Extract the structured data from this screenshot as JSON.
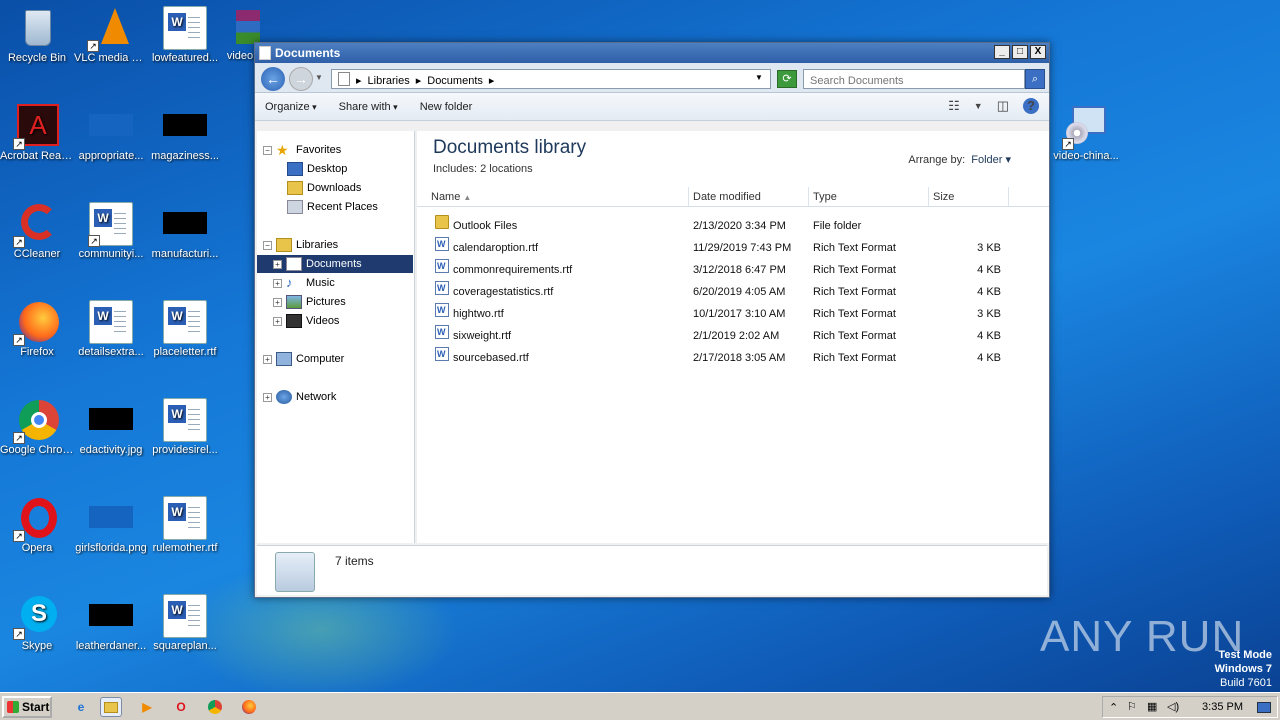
{
  "desktop": {
    "icons": [
      {
        "label": "Recycle Bin"
      },
      {
        "label": "VLC media player"
      },
      {
        "label": "lowfeatured..."
      },
      {
        "label": "video"
      },
      {
        "label": "Acrobat Reader DC"
      },
      {
        "label": "appropriate..."
      },
      {
        "label": "magaziness..."
      },
      {
        "label": "CCleaner"
      },
      {
        "label": "communityi..."
      },
      {
        "label": "manufacturi..."
      },
      {
        "label": "Firefox"
      },
      {
        "label": "detailsextra..."
      },
      {
        "label": "placeletter.rtf"
      },
      {
        "label": "Google Chrome"
      },
      {
        "label": "edactivity.jpg"
      },
      {
        "label": "providesirel..."
      },
      {
        "label": "Opera"
      },
      {
        "label": "girlsflorida.png"
      },
      {
        "label": "rulemother.rtf"
      },
      {
        "label": "Skype"
      },
      {
        "label": "leatherdaner..."
      },
      {
        "label": "squareplan..."
      },
      {
        "label": "video-china..."
      }
    ]
  },
  "window": {
    "title": "Documents",
    "buttons": {
      "minimize": "_",
      "maximize": "□",
      "close": "X"
    },
    "address": {
      "crumbs": [
        "Libraries",
        "Documents"
      ]
    },
    "search": {
      "placeholder": "Search Documents"
    },
    "toolbar": {
      "organize": "Organize",
      "share": "Share with",
      "new_folder": "New folder"
    },
    "nav": {
      "favorites": "Favorites",
      "desktop": "Desktop",
      "downloads": "Downloads",
      "recent": "Recent Places",
      "libraries": "Libraries",
      "documents": "Documents",
      "music": "Music",
      "pictures": "Pictures",
      "videos": "Videos",
      "computer": "Computer",
      "network": "Network"
    },
    "library": {
      "title": "Documents library",
      "includes": "Includes:  2 locations",
      "arrange_label": "Arrange by:",
      "arrange_value": "Folder"
    },
    "columns": {
      "name": "Name",
      "date": "Date modified",
      "type": "Type",
      "size": "Size"
    },
    "files": [
      {
        "name": "Outlook Files",
        "date": "2/13/2020 3:34 PM",
        "type": "File folder",
        "size": ""
      },
      {
        "name": "calendaroption.rtf",
        "date": "11/29/2019 7:43 PM",
        "type": "Rich Text Format",
        "size": "3 KB"
      },
      {
        "name": "commonrequirements.rtf",
        "date": "3/12/2018 6:47 PM",
        "type": "Rich Text Format",
        "size": "4 KB"
      },
      {
        "name": "coveragestatistics.rtf",
        "date": "6/20/2019 4:05 AM",
        "type": "Rich Text Format",
        "size": "4 KB"
      },
      {
        "name": "hightwo.rtf",
        "date": "10/1/2017 3:10 AM",
        "type": "Rich Text Format",
        "size": "3 KB"
      },
      {
        "name": "sixweight.rtf",
        "date": "2/1/2019 2:02 AM",
        "type": "Rich Text Format",
        "size": "4 KB"
      },
      {
        "name": "sourcebased.rtf",
        "date": "2/17/2018 3:05 AM",
        "type": "Rich Text Format",
        "size": "4 KB"
      }
    ],
    "details": {
      "count": "7 items"
    }
  },
  "taskbar": {
    "start": "Start",
    "clock": "3:35 PM"
  },
  "watermark": {
    "line1": "Test Mode",
    "line2": "Windows 7",
    "line3": "Build 7601",
    "brand": "ANY RUN"
  }
}
